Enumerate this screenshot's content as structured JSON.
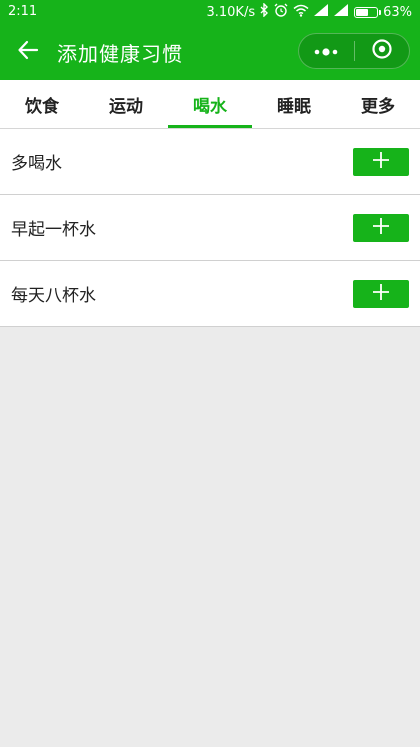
{
  "status_bar": {
    "time": "2:11",
    "network_speed": "3.10K/s",
    "battery": "63%",
    "battery_level": 0.63,
    "icons": [
      "bluetooth-icon",
      "alarm-icon",
      "wifi-icon",
      "signal-icon",
      "signal-icon",
      "battery-icon"
    ]
  },
  "app_bar": {
    "title": "添加健康习惯",
    "back_icon": "arrow-left-icon",
    "capsule_icons": [
      "more-dots-icon",
      "close-target-icon"
    ]
  },
  "tabs": [
    {
      "label": "饮食",
      "active": false
    },
    {
      "label": "运动",
      "active": false
    },
    {
      "label": "喝水",
      "active": true
    },
    {
      "label": "睡眠",
      "active": false
    },
    {
      "label": "更多",
      "active": false
    }
  ],
  "habits": [
    {
      "label": "多喝水",
      "action_icon": "plus-icon"
    },
    {
      "label": "早起一杯水",
      "action_icon": "plus-icon"
    },
    {
      "label": "每天八杯水",
      "action_icon": "plus-icon"
    }
  ],
  "colors": {
    "brand": "#16b31a",
    "background": "#ebebeb",
    "text": "#222222"
  }
}
